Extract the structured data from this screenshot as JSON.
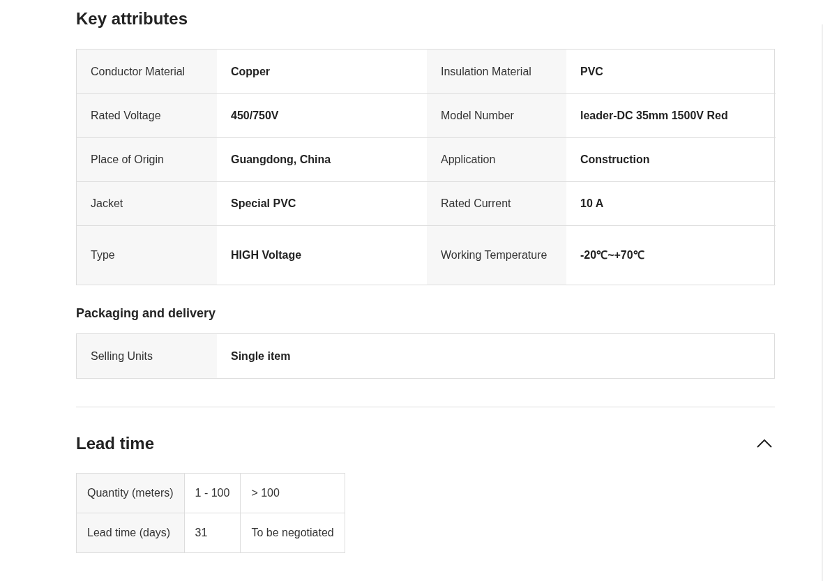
{
  "key_attributes": {
    "title": "Key attributes",
    "items": [
      {
        "label": "Conductor Material",
        "value": "Copper"
      },
      {
        "label": "Insulation Material",
        "value": "PVC"
      },
      {
        "label": "Rated Voltage",
        "value": "450/750V"
      },
      {
        "label": "Model Number",
        "value": "leader-DC 35mm 1500V Red"
      },
      {
        "label": "Place of Origin",
        "value": "Guangdong, China"
      },
      {
        "label": "Application",
        "value": "Construction"
      },
      {
        "label": "Jacket",
        "value": "Special PVC"
      },
      {
        "label": "Rated Current",
        "value": "10 A"
      },
      {
        "label": "Type",
        "value": "HIGH Voltage"
      },
      {
        "label": "Working Temperature",
        "value": "-20℃~+70℃"
      }
    ]
  },
  "packaging": {
    "title": "Packaging and delivery",
    "items": [
      {
        "label": "Selling Units",
        "value": "Single item"
      }
    ]
  },
  "lead_time": {
    "title": "Lead time",
    "expanded": true,
    "rows": [
      [
        "Quantity (meters)",
        "1 - 100",
        "> 100"
      ],
      [
        "Lead time (days)",
        "31",
        "To be negotiated"
      ]
    ]
  }
}
